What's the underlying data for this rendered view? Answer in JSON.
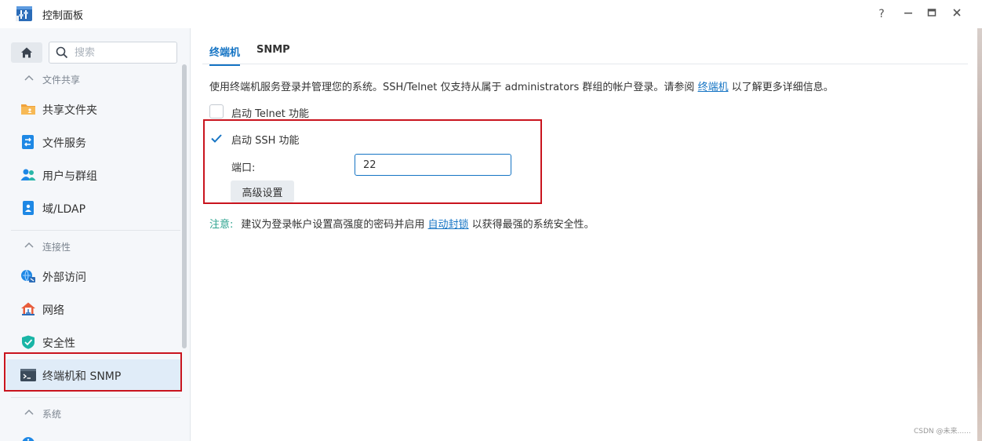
{
  "window": {
    "title": "控制面板",
    "help": "?",
    "minimize": "−",
    "maximize": "□",
    "close": "✕"
  },
  "sidebar": {
    "search_placeholder": "搜索",
    "groups": [
      {
        "label": "文件共享"
      },
      {
        "label": "连接性"
      },
      {
        "label": "系统"
      }
    ],
    "items": [
      {
        "label": "共享文件夹",
        "icon": "shared-folder-icon"
      },
      {
        "label": "文件服务",
        "icon": "file-services-icon"
      },
      {
        "label": "用户与群组",
        "icon": "users-groups-icon"
      },
      {
        "label": "域/LDAP",
        "icon": "domain-ldap-icon"
      },
      {
        "label": "外部访问",
        "icon": "external-access-icon"
      },
      {
        "label": "网络",
        "icon": "network-icon"
      },
      {
        "label": "安全性",
        "icon": "security-shield-icon"
      },
      {
        "label": "终端机和 SNMP",
        "icon": "terminal-icon",
        "active": true
      }
    ]
  },
  "main": {
    "tabs": [
      {
        "label": "终端机",
        "active": true
      },
      {
        "label": "SNMP"
      }
    ],
    "description": {
      "before": "使用终端机服务登录并管理您的系统。SSH/Telnet 仅支持从属于 administrators 群组的帐户登录。请参阅 ",
      "link": "终端机",
      "after": " 以了解更多详细信息。"
    },
    "telnet": {
      "label": "启动 Telnet 功能",
      "checked": false
    },
    "ssh": {
      "label": "启动 SSH 功能",
      "checked": true
    },
    "port": {
      "label": "端口:",
      "value": "22"
    },
    "advanced_button": "高级设置",
    "note": {
      "label": "注意:",
      "before": "建议为登录帐户设置高强度的密码并启用 ",
      "link": "自动封锁",
      "after": " 以获得最强的系统安全性。"
    }
  },
  "watermark": "CSDN @未来......",
  "colors": {
    "accent": "#1574c4",
    "highlight_box": "#c9141e",
    "note_label": "#2aa28e",
    "active_item_bg": "#e0ecf8"
  }
}
